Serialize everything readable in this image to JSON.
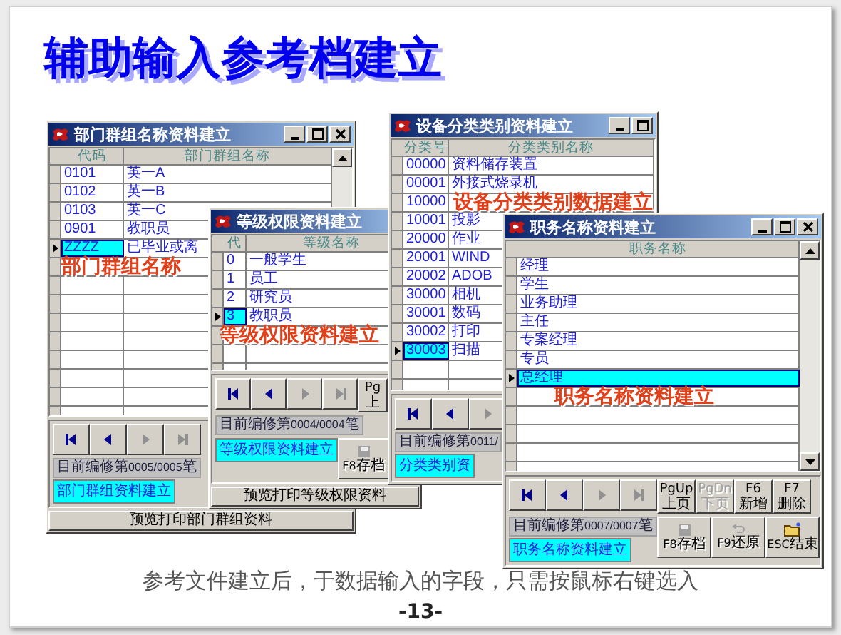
{
  "slide": {
    "title": "辅助输入参考档建立",
    "caption": "参考文件建立后，于数据输入的字段，只需按鼠标右键选入",
    "page": "-13-"
  },
  "windows": [
    {
      "title": "部门群组名称资料建立",
      "title_buttons": [
        {
          "kind": "minimize"
        },
        {
          "kind": "maximize"
        },
        {
          "kind": "close"
        }
      ],
      "columns": [
        "代码",
        "部门群组名称"
      ],
      "rows": [
        {
          "cells": [
            "0101",
            "英一A"
          ],
          "selected": false
        },
        {
          "cells": [
            "0102",
            "英一B"
          ],
          "selected": false
        },
        {
          "cells": [
            "0103",
            "英一C"
          ],
          "selected": false
        },
        {
          "cells": [
            "0901",
            "教职员"
          ],
          "selected": false
        },
        {
          "cells": [
            "ZZZZ",
            "已毕业或离"
          ],
          "selected": true
        }
      ],
      "caption": "部门群组名称",
      "nav": [
        {
          "kind": "first",
          "disabled": false
        },
        {
          "kind": "prev",
          "disabled": false
        },
        {
          "kind": "next",
          "disabled": true
        },
        {
          "kind": "last",
          "disabled": true
        }
      ],
      "status": "目前编修第0005/0005笔",
      "label": "部门群组资料建立",
      "print_bar": "预览打印部门群组资料"
    },
    {
      "title": "等级权限资料建立",
      "columns": [
        "代",
        "等级名称"
      ],
      "rows": [
        {
          "cells": [
            "0",
            "一般学生"
          ],
          "selected": false
        },
        {
          "cells": [
            "1",
            "员工"
          ],
          "selected": false
        },
        {
          "cells": [
            "2",
            "研究员"
          ],
          "selected": false
        },
        {
          "cells": [
            "3",
            "教职员"
          ],
          "selected": true
        }
      ],
      "caption": "等级权限资料建立",
      "nav": [
        {
          "kind": "first",
          "disabled": false
        },
        {
          "kind": "prev",
          "disabled": false
        },
        {
          "kind": "next",
          "disabled": true
        },
        {
          "kind": "last",
          "disabled": true
        }
      ],
      "keys": [
        {
          "key": "Pg",
          "label": "上",
          "disabled": false
        }
      ],
      "status": "目前编修第0004/0004笔",
      "label": "等级权限资料建立",
      "actions": [
        {
          "kind": "save",
          "key": "F8",
          "label": "存档",
          "disabled": true
        }
      ],
      "print_bar": "预览打印等级权限资料"
    },
    {
      "title": "设备分类类别资料建立",
      "title_buttons": [
        {
          "kind": "minimize"
        },
        {
          "kind": "maximize"
        }
      ],
      "columns": [
        "分类号",
        "分类类别名称"
      ],
      "rows": [
        {
          "cells": [
            "00000",
            "资料储存装置"
          ],
          "selected": false
        },
        {
          "cells": [
            "00001",
            "外接式烧录机"
          ],
          "selected": false
        },
        {
          "cells": [
            "10000"
          ],
          "selected": false
        },
        {
          "cells": [
            "10001",
            "投影"
          ],
          "selected": false
        },
        {
          "cells": [
            "20000",
            "作业"
          ],
          "selected": false
        },
        {
          "cells": [
            "20001",
            "WIND"
          ],
          "selected": false
        },
        {
          "cells": [
            "20002",
            "ADOB"
          ],
          "selected": false
        },
        {
          "cells": [
            "30000",
            "相机"
          ],
          "selected": false
        },
        {
          "cells": [
            "30001",
            "数码"
          ],
          "selected": false
        },
        {
          "cells": [
            "30002",
            "打印"
          ],
          "selected": false
        },
        {
          "cells": [
            "30003",
            "扫描"
          ],
          "selected": true
        }
      ],
      "caption": "设备分类类别数据建立",
      "nav": [
        {
          "kind": "first",
          "disabled": false
        },
        {
          "kind": "prev",
          "disabled": false
        },
        {
          "kind": "next",
          "disabled": true
        }
      ],
      "status": "目前编修第0011/",
      "label": "分类类别资"
    },
    {
      "title": "职务名称资料建立",
      "title_buttons": [
        {
          "kind": "minimize"
        },
        {
          "kind": "maximize"
        },
        {
          "kind": "close"
        }
      ],
      "columns": [
        "职务名称"
      ],
      "rows": [
        {
          "cells": [
            "经理"
          ],
          "selected": false
        },
        {
          "cells": [
            "学生"
          ],
          "selected": false
        },
        {
          "cells": [
            "业务助理"
          ],
          "selected": false
        },
        {
          "cells": [
            "主任"
          ],
          "selected": false
        },
        {
          "cells": [
            "专案经理"
          ],
          "selected": false
        },
        {
          "cells": [
            "专员"
          ],
          "selected": false
        },
        {
          "cells": [
            "总经理"
          ],
          "selected": true
        }
      ],
      "caption": "职务名称资料建立",
      "nav": [
        {
          "kind": "first",
          "disabled": false
        },
        {
          "kind": "prev",
          "disabled": false
        },
        {
          "kind": "next",
          "disabled": true
        },
        {
          "kind": "last",
          "disabled": true
        }
      ],
      "keys": [
        {
          "key": "PgUp",
          "label": "上页",
          "disabled": false
        },
        {
          "key": "PgDn",
          "label": "下页",
          "disabled": true
        },
        {
          "key": "F6",
          "label": "新增",
          "disabled": false
        },
        {
          "key": "F7",
          "label": "删除",
          "disabled": false
        }
      ],
      "status": "目前编修第0007/0007笔",
      "label": "职务名称资料建立",
      "actions": [
        {
          "kind": "save",
          "key": "F8",
          "label": "存档",
          "disabled": true
        },
        {
          "kind": "undo",
          "key": "F9",
          "label": "还原",
          "disabled": true
        },
        {
          "kind": "exit",
          "key": "ESC",
          "label": "结束",
          "disabled": false
        }
      ]
    }
  ]
}
